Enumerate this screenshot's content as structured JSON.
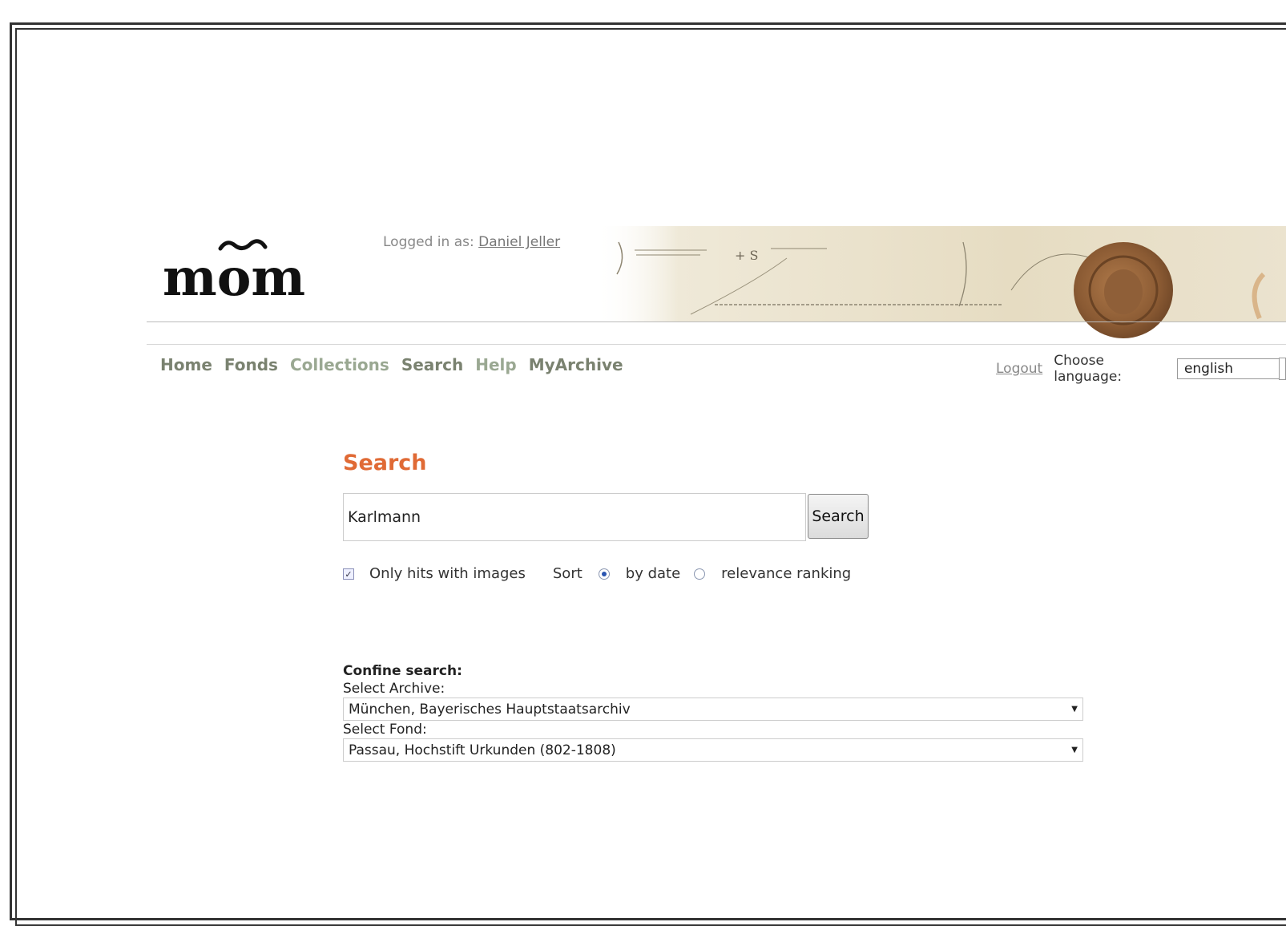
{
  "header": {
    "logo_text": "mom",
    "logged_in_label": "Logged in as:",
    "user_name": "Daniel Jeller"
  },
  "nav": {
    "items": [
      {
        "label": "Home",
        "tone": "dark"
      },
      {
        "label": "Fonds",
        "tone": "dark"
      },
      {
        "label": "Collections",
        "tone": "light"
      },
      {
        "label": "Search",
        "tone": "dark"
      },
      {
        "label": "Help",
        "tone": "light"
      },
      {
        "label": "MyArchive",
        "tone": "dark"
      }
    ],
    "logout": "Logout",
    "language_label": "Choose language:",
    "language_value": "english"
  },
  "search": {
    "title": "Search",
    "query": "Karlmann",
    "button": "Search",
    "only_images_label": "Only hits with images",
    "only_images_checked": true,
    "sort_label": "Sort",
    "sort_by_date": "by date",
    "sort_relevance": "relevance ranking",
    "sort_selected": "by date"
  },
  "confine": {
    "heading": "Confine search:",
    "archive_label": "Select Archive:",
    "archive_value": "München, Bayerisches Hauptstaatsarchiv",
    "fond_label": "Select Fond:",
    "fond_value": "Passau, Hochstift Urkunden (802-1808)"
  },
  "colors": {
    "title_accent": "#e06a35",
    "nav_dark": "#7a8270",
    "nav_light": "#9aa892"
  }
}
